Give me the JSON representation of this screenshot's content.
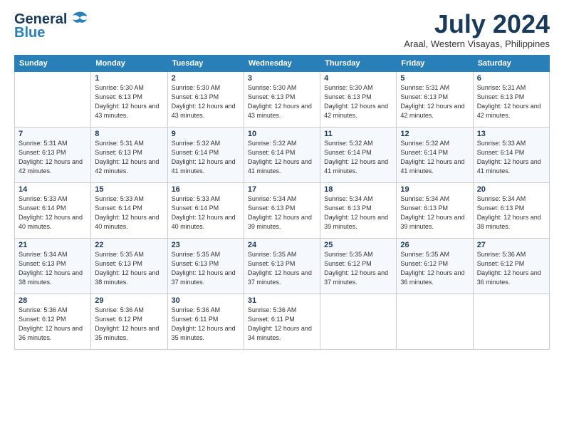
{
  "logo": {
    "line1": "General",
    "line2": "Blue"
  },
  "header": {
    "month": "July 2024",
    "location": "Araal, Western Visayas, Philippines"
  },
  "weekdays": [
    "Sunday",
    "Monday",
    "Tuesday",
    "Wednesday",
    "Thursday",
    "Friday",
    "Saturday"
  ],
  "weeks": [
    [
      {
        "day": "",
        "sunrise": "",
        "sunset": "",
        "daylight": ""
      },
      {
        "day": "1",
        "sunrise": "Sunrise: 5:30 AM",
        "sunset": "Sunset: 6:13 PM",
        "daylight": "Daylight: 12 hours and 43 minutes."
      },
      {
        "day": "2",
        "sunrise": "Sunrise: 5:30 AM",
        "sunset": "Sunset: 6:13 PM",
        "daylight": "Daylight: 12 hours and 43 minutes."
      },
      {
        "day": "3",
        "sunrise": "Sunrise: 5:30 AM",
        "sunset": "Sunset: 6:13 PM",
        "daylight": "Daylight: 12 hours and 43 minutes."
      },
      {
        "day": "4",
        "sunrise": "Sunrise: 5:30 AM",
        "sunset": "Sunset: 6:13 PM",
        "daylight": "Daylight: 12 hours and 42 minutes."
      },
      {
        "day": "5",
        "sunrise": "Sunrise: 5:31 AM",
        "sunset": "Sunset: 6:13 PM",
        "daylight": "Daylight: 12 hours and 42 minutes."
      },
      {
        "day": "6",
        "sunrise": "Sunrise: 5:31 AM",
        "sunset": "Sunset: 6:13 PM",
        "daylight": "Daylight: 12 hours and 42 minutes."
      }
    ],
    [
      {
        "day": "7",
        "sunrise": "Sunrise: 5:31 AM",
        "sunset": "Sunset: 6:13 PM",
        "daylight": "Daylight: 12 hours and 42 minutes."
      },
      {
        "day": "8",
        "sunrise": "Sunrise: 5:31 AM",
        "sunset": "Sunset: 6:13 PM",
        "daylight": "Daylight: 12 hours and 42 minutes."
      },
      {
        "day": "9",
        "sunrise": "Sunrise: 5:32 AM",
        "sunset": "Sunset: 6:14 PM",
        "daylight": "Daylight: 12 hours and 41 minutes."
      },
      {
        "day": "10",
        "sunrise": "Sunrise: 5:32 AM",
        "sunset": "Sunset: 6:14 PM",
        "daylight": "Daylight: 12 hours and 41 minutes."
      },
      {
        "day": "11",
        "sunrise": "Sunrise: 5:32 AM",
        "sunset": "Sunset: 6:14 PM",
        "daylight": "Daylight: 12 hours and 41 minutes."
      },
      {
        "day": "12",
        "sunrise": "Sunrise: 5:32 AM",
        "sunset": "Sunset: 6:14 PM",
        "daylight": "Daylight: 12 hours and 41 minutes."
      },
      {
        "day": "13",
        "sunrise": "Sunrise: 5:33 AM",
        "sunset": "Sunset: 6:14 PM",
        "daylight": "Daylight: 12 hours and 41 minutes."
      }
    ],
    [
      {
        "day": "14",
        "sunrise": "Sunrise: 5:33 AM",
        "sunset": "Sunset: 6:14 PM",
        "daylight": "Daylight: 12 hours and 40 minutes."
      },
      {
        "day": "15",
        "sunrise": "Sunrise: 5:33 AM",
        "sunset": "Sunset: 6:14 PM",
        "daylight": "Daylight: 12 hours and 40 minutes."
      },
      {
        "day": "16",
        "sunrise": "Sunrise: 5:33 AM",
        "sunset": "Sunset: 6:14 PM",
        "daylight": "Daylight: 12 hours and 40 minutes."
      },
      {
        "day": "17",
        "sunrise": "Sunrise: 5:34 AM",
        "sunset": "Sunset: 6:13 PM",
        "daylight": "Daylight: 12 hours and 39 minutes."
      },
      {
        "day": "18",
        "sunrise": "Sunrise: 5:34 AM",
        "sunset": "Sunset: 6:13 PM",
        "daylight": "Daylight: 12 hours and 39 minutes."
      },
      {
        "day": "19",
        "sunrise": "Sunrise: 5:34 AM",
        "sunset": "Sunset: 6:13 PM",
        "daylight": "Daylight: 12 hours and 39 minutes."
      },
      {
        "day": "20",
        "sunrise": "Sunrise: 5:34 AM",
        "sunset": "Sunset: 6:13 PM",
        "daylight": "Daylight: 12 hours and 38 minutes."
      }
    ],
    [
      {
        "day": "21",
        "sunrise": "Sunrise: 5:34 AM",
        "sunset": "Sunset: 6:13 PM",
        "daylight": "Daylight: 12 hours and 38 minutes."
      },
      {
        "day": "22",
        "sunrise": "Sunrise: 5:35 AM",
        "sunset": "Sunset: 6:13 PM",
        "daylight": "Daylight: 12 hours and 38 minutes."
      },
      {
        "day": "23",
        "sunrise": "Sunrise: 5:35 AM",
        "sunset": "Sunset: 6:13 PM",
        "daylight": "Daylight: 12 hours and 37 minutes."
      },
      {
        "day": "24",
        "sunrise": "Sunrise: 5:35 AM",
        "sunset": "Sunset: 6:13 PM",
        "daylight": "Daylight: 12 hours and 37 minutes."
      },
      {
        "day": "25",
        "sunrise": "Sunrise: 5:35 AM",
        "sunset": "Sunset: 6:12 PM",
        "daylight": "Daylight: 12 hours and 37 minutes."
      },
      {
        "day": "26",
        "sunrise": "Sunrise: 5:35 AM",
        "sunset": "Sunset: 6:12 PM",
        "daylight": "Daylight: 12 hours and 36 minutes."
      },
      {
        "day": "27",
        "sunrise": "Sunrise: 5:36 AM",
        "sunset": "Sunset: 6:12 PM",
        "daylight": "Daylight: 12 hours and 36 minutes."
      }
    ],
    [
      {
        "day": "28",
        "sunrise": "Sunrise: 5:36 AM",
        "sunset": "Sunset: 6:12 PM",
        "daylight": "Daylight: 12 hours and 36 minutes."
      },
      {
        "day": "29",
        "sunrise": "Sunrise: 5:36 AM",
        "sunset": "Sunset: 6:12 PM",
        "daylight": "Daylight: 12 hours and 35 minutes."
      },
      {
        "day": "30",
        "sunrise": "Sunrise: 5:36 AM",
        "sunset": "Sunset: 6:11 PM",
        "daylight": "Daylight: 12 hours and 35 minutes."
      },
      {
        "day": "31",
        "sunrise": "Sunrise: 5:36 AM",
        "sunset": "Sunset: 6:11 PM",
        "daylight": "Daylight: 12 hours and 34 minutes."
      },
      {
        "day": "",
        "sunrise": "",
        "sunset": "",
        "daylight": ""
      },
      {
        "day": "",
        "sunrise": "",
        "sunset": "",
        "daylight": ""
      },
      {
        "day": "",
        "sunrise": "",
        "sunset": "",
        "daylight": ""
      }
    ]
  ]
}
